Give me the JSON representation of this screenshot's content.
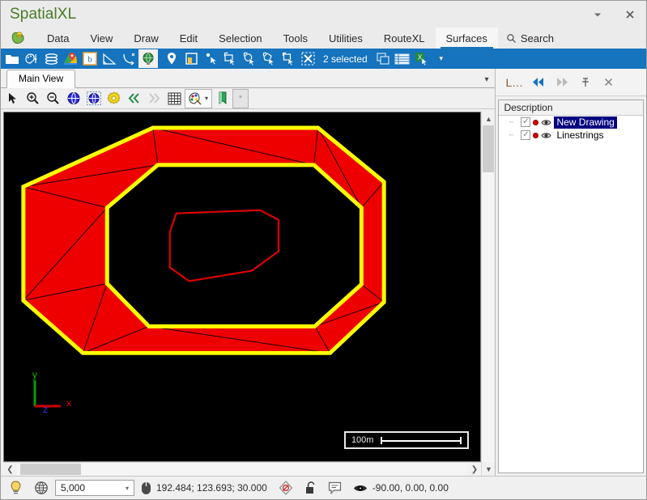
{
  "window": {
    "title": "SpatialXL",
    "minimize_label": "▾",
    "close_label": "✕"
  },
  "menu": {
    "logo_icon": "app-logo-icon",
    "items": [
      {
        "label": "Data",
        "active": false
      },
      {
        "label": "View",
        "active": false
      },
      {
        "label": "Draw",
        "active": false
      },
      {
        "label": "Edit",
        "active": false
      },
      {
        "label": "Selection",
        "active": false
      },
      {
        "label": "Tools",
        "active": false
      },
      {
        "label": "Utilities",
        "active": false
      },
      {
        "label": "RouteXL",
        "active": false
      },
      {
        "label": "Surfaces",
        "active": true
      }
    ],
    "search_label": "Search",
    "search_icon": "search-icon"
  },
  "command_toolbar": {
    "selection_status": "2 selected",
    "overflow_label": "▾",
    "buttons": [
      {
        "name": "open-folder-icon"
      },
      {
        "name": "palette-settings-icon"
      },
      {
        "name": "layers-icon"
      },
      {
        "name": "map-pin-icon"
      },
      {
        "name": "bing-maps-icon"
      },
      {
        "name": "measure-angle-icon"
      },
      {
        "name": "curve-tool-icon"
      },
      {
        "name": "globe-icon"
      },
      {
        "name": "place-marker-icon"
      },
      {
        "name": "area-select-icon"
      },
      {
        "name": "point-select-icon"
      },
      {
        "name": "rectangle-select-icon"
      },
      {
        "name": "circle-select-icon"
      },
      {
        "name": "polygon-select-icon"
      },
      {
        "name": "box-select-icon"
      },
      {
        "name": "clear-selection-icon"
      },
      {
        "name": "copy-selection-icon"
      },
      {
        "name": "table-view-icon"
      },
      {
        "name": "export-excel-icon"
      }
    ]
  },
  "view_tabs": {
    "tabs": [
      {
        "label": "Main View",
        "active": true
      }
    ],
    "overflow_label": "▾"
  },
  "view_toolbar": {
    "buttons": [
      {
        "name": "pointer-tool-icon"
      },
      {
        "name": "zoom-in-icon"
      },
      {
        "name": "zoom-out-icon"
      },
      {
        "name": "zoom-extents-icon"
      },
      {
        "name": "zoom-selection-icon"
      },
      {
        "name": "view-settings-icon"
      },
      {
        "name": "previous-view-icon"
      },
      {
        "name": "next-view-icon"
      },
      {
        "name": "grid-toggle-icon"
      },
      {
        "name": "color-palette-icon"
      },
      {
        "name": "bookmark-icon"
      },
      {
        "name": "favorite-icon"
      }
    ],
    "star_label": "*"
  },
  "canvas": {
    "background_color": "#000000",
    "scale_bar": {
      "label": "100m"
    },
    "axis": {
      "x_label": "x",
      "y_label": "y",
      "z_label": "z",
      "x_color": "#d00000",
      "y_color": "#00a000",
      "z_color": "#0000ee"
    },
    "shapes": {
      "outer_ring_stroke": "#ffff00",
      "ring_fill": "#ee0000",
      "inner_polyline_stroke": "#dd0000",
      "triangulation_stroke": "#000000"
    }
  },
  "layers_panel": {
    "title": "L...",
    "prev_label": "◀◀",
    "next_label": "▶▶",
    "pin_icon": "pin-icon",
    "close_label": "✕",
    "column_header": "Description",
    "rows": [
      {
        "label": "New Drawing",
        "checked": true,
        "selected": true,
        "color": "#e00000",
        "visibility_icon": "eye-icon"
      },
      {
        "label": "Linestrings",
        "checked": true,
        "selected": false,
        "color": "#e00000",
        "visibility_icon": "eye-icon"
      }
    ]
  },
  "status_bar": {
    "tip_icon": "lightbulb-icon",
    "globe_icon": "wireframe-globe-icon",
    "scale_value": "5,000",
    "scale_arrow": "▾",
    "mouse_icon": "mouse-icon",
    "coordinates": "192.484; 123.693; 30.000",
    "snap_icon": "snap-icon",
    "lock_icon": "unlock-icon",
    "comment_icon": "comment-icon",
    "view_icon": "eye-icon",
    "view_angles": "-90.00, 0.00, 0.00"
  }
}
